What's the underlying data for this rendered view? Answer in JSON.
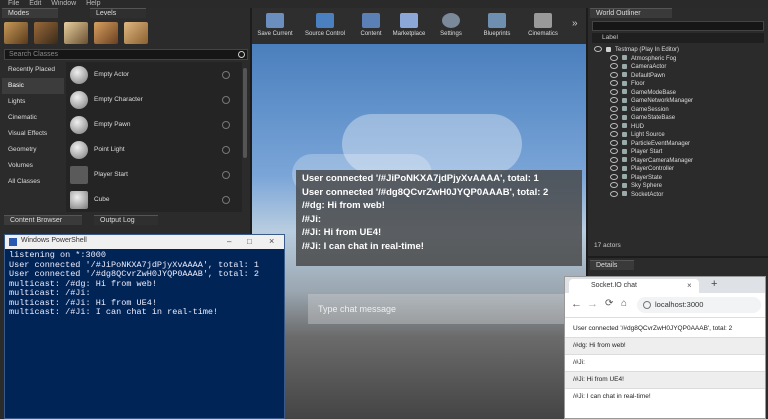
{
  "menu": [
    "File",
    "Edit",
    "Window",
    "Help"
  ],
  "tabs": {
    "modes": "Modes",
    "levels": "Levels",
    "content_browser": "Content Browser",
    "output_log": "Output Log",
    "world_outliner": "World Outliner",
    "details": "Details"
  },
  "modes_panel": {
    "search_placeholder": "Search Classes",
    "categories": [
      "Recently Placed",
      "Basic",
      "Lights",
      "Cinematic",
      "Visual Effects",
      "Geometry",
      "Volumes",
      "All Classes"
    ],
    "selected_category": "Basic",
    "actors": [
      "Empty Actor",
      "Empty Character",
      "Empty Pawn",
      "Point Light",
      "Player Start",
      "Cube"
    ]
  },
  "toolbar": {
    "buttons": [
      "Save Current",
      "Source Control",
      "Content",
      "Marketplace",
      "Settings",
      "Blueprints",
      "Cinematics"
    ],
    "colors": [
      "#6a8fbf",
      "#4a7fc0",
      "#5a80b5",
      "#8aa7d8",
      "#7a8a9a",
      "#6f8fb0",
      "#9a9a9a"
    ]
  },
  "viewport": {
    "messages": [
      "User connected '/#JiPoNKXA7jdPjyXvAAAA', total: 1",
      "User connected '/#dg8QCvrZwH0JYQP0AAAB', total: 2",
      "/#dg: Hi from web!",
      "/#Ji:",
      "/#Ji: Hi from UE4!",
      "/#Ji: I can chat in real-time!"
    ],
    "input_placeholder": "Type chat message"
  },
  "outliner": {
    "search_placeholder": "Label",
    "root": "Testmap (Play In Editor)",
    "items": [
      "Atmospheric Fog",
      "CameraActor",
      "DefaultPawn",
      "Floor",
      "GameModeBase",
      "GameNetworkManager",
      "GameSession",
      "GameStateBase",
      "HUD",
      "Light Source",
      "ParticleEventManager",
      "Player Start",
      "PlayerCameraManager",
      "PlayerController",
      "PlayerState",
      "Sky Sphere",
      "SocketActor"
    ],
    "count": "17 actors"
  },
  "powershell": {
    "title": "Windows PowerShell",
    "lines": [
      "listening on *:3000",
      "User connected '/#JiPoNKXA7jdPjyXvAAAA', total: 1",
      "",
      "User connected '/#dg8QCvrZwH0JYQP0AAAB', total: 2",
      "multicast: /#dg: Hi from web!",
      "multicast: /#Ji:",
      "multicast: /#Ji: Hi from UE4!",
      "multicast: /#Ji: I can chat in real-time!"
    ]
  },
  "browser": {
    "tab_title": "Socket.IO chat",
    "url": "localhost:3000",
    "messages": [
      "User connected '/#dg8QCvrZwH0JYQP0AAAB', total: 2",
      "/#dg: Hi from web!",
      "/#Ji:",
      "/#Ji: Hi from UE4!",
      "/#Ji: I can chat in real-time!"
    ]
  }
}
